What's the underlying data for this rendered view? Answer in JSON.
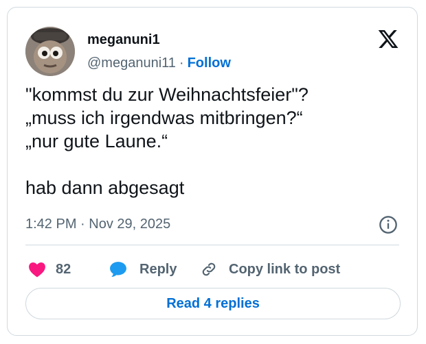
{
  "author": {
    "display_name": "meganuni1",
    "handle": "@meganuni11",
    "separator": "·",
    "follow_label": "Follow"
  },
  "tweet": {
    "lines": [
      "\"kommst du zur Weihnachtsfeier\"?",
      "„muss ich irgendwas mitbringen?“",
      "„nur gute Laune.“",
      "",
      "hab dann abgesagt"
    ],
    "timestamp": "1:42 PM · Nov 29, 2025"
  },
  "actions": {
    "like_count": "82",
    "reply_label": "Reply",
    "copy_link_label": "Copy link to post"
  },
  "footer": {
    "read_replies_label": "Read 4 replies"
  },
  "colors": {
    "accent": "#006fd6",
    "like": "#f91880",
    "reply_icon": "#1d9bf0",
    "muted": "#536471",
    "border": "#cfd9de"
  },
  "icons": {
    "brand": "x-logo-icon",
    "info": "info-icon",
    "like": "heart-icon",
    "reply": "speech-bubble-icon",
    "copy": "link-icon"
  }
}
